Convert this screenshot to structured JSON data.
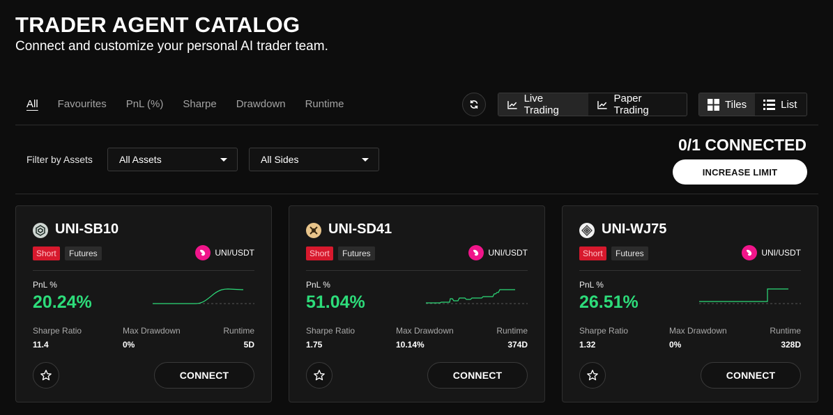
{
  "header": {
    "title": "TRADER AGENT CATALOG",
    "subtitle": "Connect and customize your personal AI trader team."
  },
  "sort_tabs": [
    "All",
    "Favourites",
    "PnL (%)",
    "Sharpe",
    "Drawdown",
    "Runtime"
  ],
  "active_tab": "All",
  "mode_toggle": {
    "live": "Live Trading",
    "paper": "Paper Trading",
    "active": "live"
  },
  "view_toggle": {
    "tiles": "Tiles",
    "list": "List",
    "active": "tiles"
  },
  "filters": {
    "label": "Filter by Assets",
    "assets": "All Assets",
    "sides": "All Sides"
  },
  "connection": {
    "count": "0/1 CONNECTED",
    "button": "INCREASE LIMIT"
  },
  "colors": {
    "short": "#d7192d",
    "positive": "#2ddc7a",
    "pair_icon": "#f0158a"
  },
  "cards": [
    {
      "name": "UNI-SB10",
      "logo": "hexagon-logo-icon",
      "side": "Short",
      "market": "Futures",
      "pair": "UNI/USDT",
      "pnl_label": "PnL %",
      "pnl": "20.24%",
      "sharpe_label": "Sharpe Ratio",
      "sharpe": "11.4",
      "drawdown_label": "Max Drawdown",
      "drawdown": "0%",
      "runtime_label": "Runtime",
      "runtime": "5D",
      "connect": "CONNECT"
    },
    {
      "name": "UNI-SD41",
      "logo": "cross-logo-icon",
      "side": "Short",
      "market": "Futures",
      "pair": "UNI/USDT",
      "pnl_label": "PnL %",
      "pnl": "51.04%",
      "sharpe_label": "Sharpe Ratio",
      "sharpe": "1.75",
      "drawdown_label": "Max Drawdown",
      "drawdown": "10.14%",
      "runtime_label": "Runtime",
      "runtime": "374D",
      "connect": "CONNECT"
    },
    {
      "name": "UNI-WJ75",
      "logo": "diamond-logo-icon",
      "side": "Short",
      "market": "Futures",
      "pair": "UNI/USDT",
      "pnl_label": "PnL %",
      "pnl": "26.51%",
      "sharpe_label": "Sharpe Ratio",
      "sharpe": "1.32",
      "drawdown_label": "Max Drawdown",
      "drawdown": "0%",
      "runtime_label": "Runtime",
      "runtime": "328D",
      "connect": "CONNECT"
    }
  ]
}
